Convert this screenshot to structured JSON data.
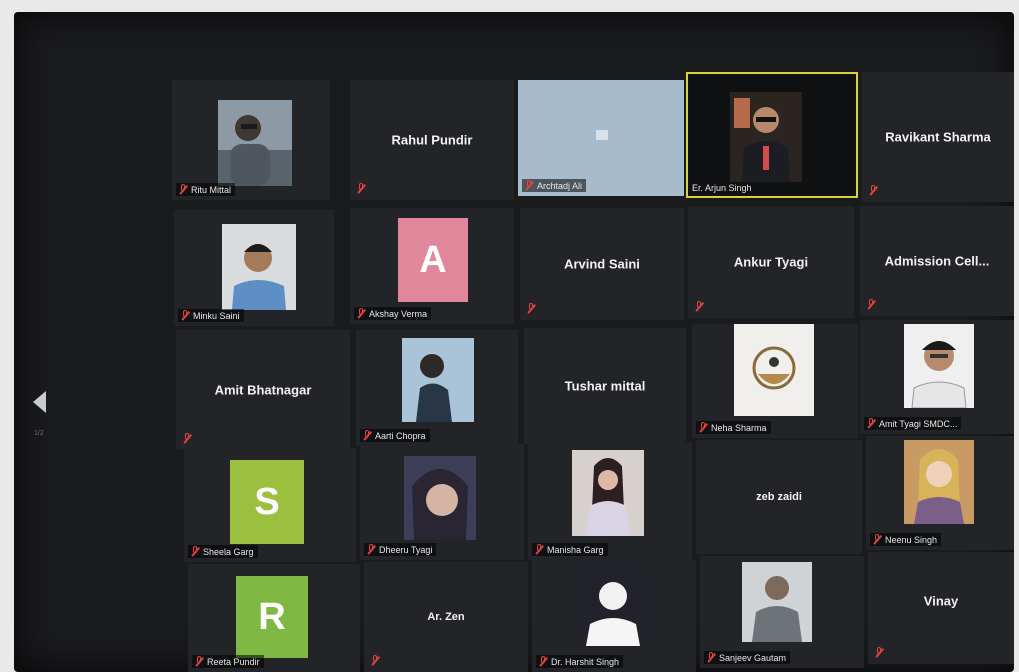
{
  "navigation": {
    "prev_arrow_icon": "chevron-left-icon",
    "page_indicator": "1/2"
  },
  "colors": {
    "tile_bg": "#232427",
    "active_speaker": "#d9d23c",
    "muted_mic": "#e3413f",
    "avatar_pink": "#e0879b",
    "avatar_green": "#9bbf3e"
  },
  "participants": [
    {
      "id": "r1c1",
      "label": "Ritu Mittal",
      "display": "photo",
      "muted": true
    },
    {
      "id": "r1c2",
      "name": "Rahul Pundir",
      "display": "name",
      "muted": true
    },
    {
      "id": "r1c3",
      "label": "Archtadj Ali",
      "display": "screen",
      "muted": true
    },
    {
      "id": "r1c4",
      "label": "Er. Arjun Singh",
      "display": "photo",
      "muted": false,
      "active": true
    },
    {
      "id": "r1c5",
      "name": "Ravikant Sharma",
      "display": "name",
      "muted": true
    },
    {
      "id": "r2c1",
      "label": "Minku Saini",
      "display": "photo",
      "muted": true
    },
    {
      "id": "r2c2",
      "label": "Akshay Verma",
      "display": "avatar",
      "initial": "A",
      "muted": true
    },
    {
      "id": "r2c3",
      "name": "Arvind Saini",
      "display": "name",
      "muted": true
    },
    {
      "id": "r2c4",
      "name": "Ankur Tyagi",
      "display": "name",
      "muted": true
    },
    {
      "id": "r2c5",
      "name": "Admission Cell...",
      "display": "name",
      "muted": true
    },
    {
      "id": "r3c1",
      "name": "Amit Bhatnagar",
      "display": "name",
      "muted": true
    },
    {
      "id": "r3c2",
      "label": "Aarti Chopra",
      "display": "photo",
      "muted": true
    },
    {
      "id": "r3c3",
      "name": "Tushar mittal",
      "display": "name",
      "muted": false
    },
    {
      "id": "r3c4",
      "label": "Neha Sharma",
      "display": "photo",
      "muted": true
    },
    {
      "id": "r3c5",
      "label": "Amit Tyagi SMDC...",
      "display": "photo",
      "muted": true
    },
    {
      "id": "r4c1",
      "label": "Sheela Garg",
      "display": "avatar",
      "initial": "S",
      "muted": true
    },
    {
      "id": "r4c2",
      "label": "Dheeru Tyagi",
      "display": "photo",
      "muted": true
    },
    {
      "id": "r4c3",
      "label": "Manisha Garg",
      "display": "photo",
      "muted": true
    },
    {
      "id": "r4c4",
      "name": "zeb zaidi",
      "display": "name",
      "muted": false
    },
    {
      "id": "r4c5",
      "label": "Neenu Singh",
      "display": "photo",
      "muted": true
    },
    {
      "id": "r5c1",
      "label": "Reeta Pundir",
      "display": "avatar",
      "initial": "R",
      "muted": true
    },
    {
      "id": "r5c2",
      "name": "Ar. Zen",
      "display": "name",
      "muted": true
    },
    {
      "id": "r5c3",
      "label": "Dr. Harshit Singh",
      "display": "photo",
      "muted": true
    },
    {
      "id": "r5c4",
      "label": "Sanjeev Gautam",
      "display": "photo",
      "muted": true
    },
    {
      "id": "r5c5",
      "name": "Vinay",
      "display": "name",
      "muted": true
    }
  ]
}
